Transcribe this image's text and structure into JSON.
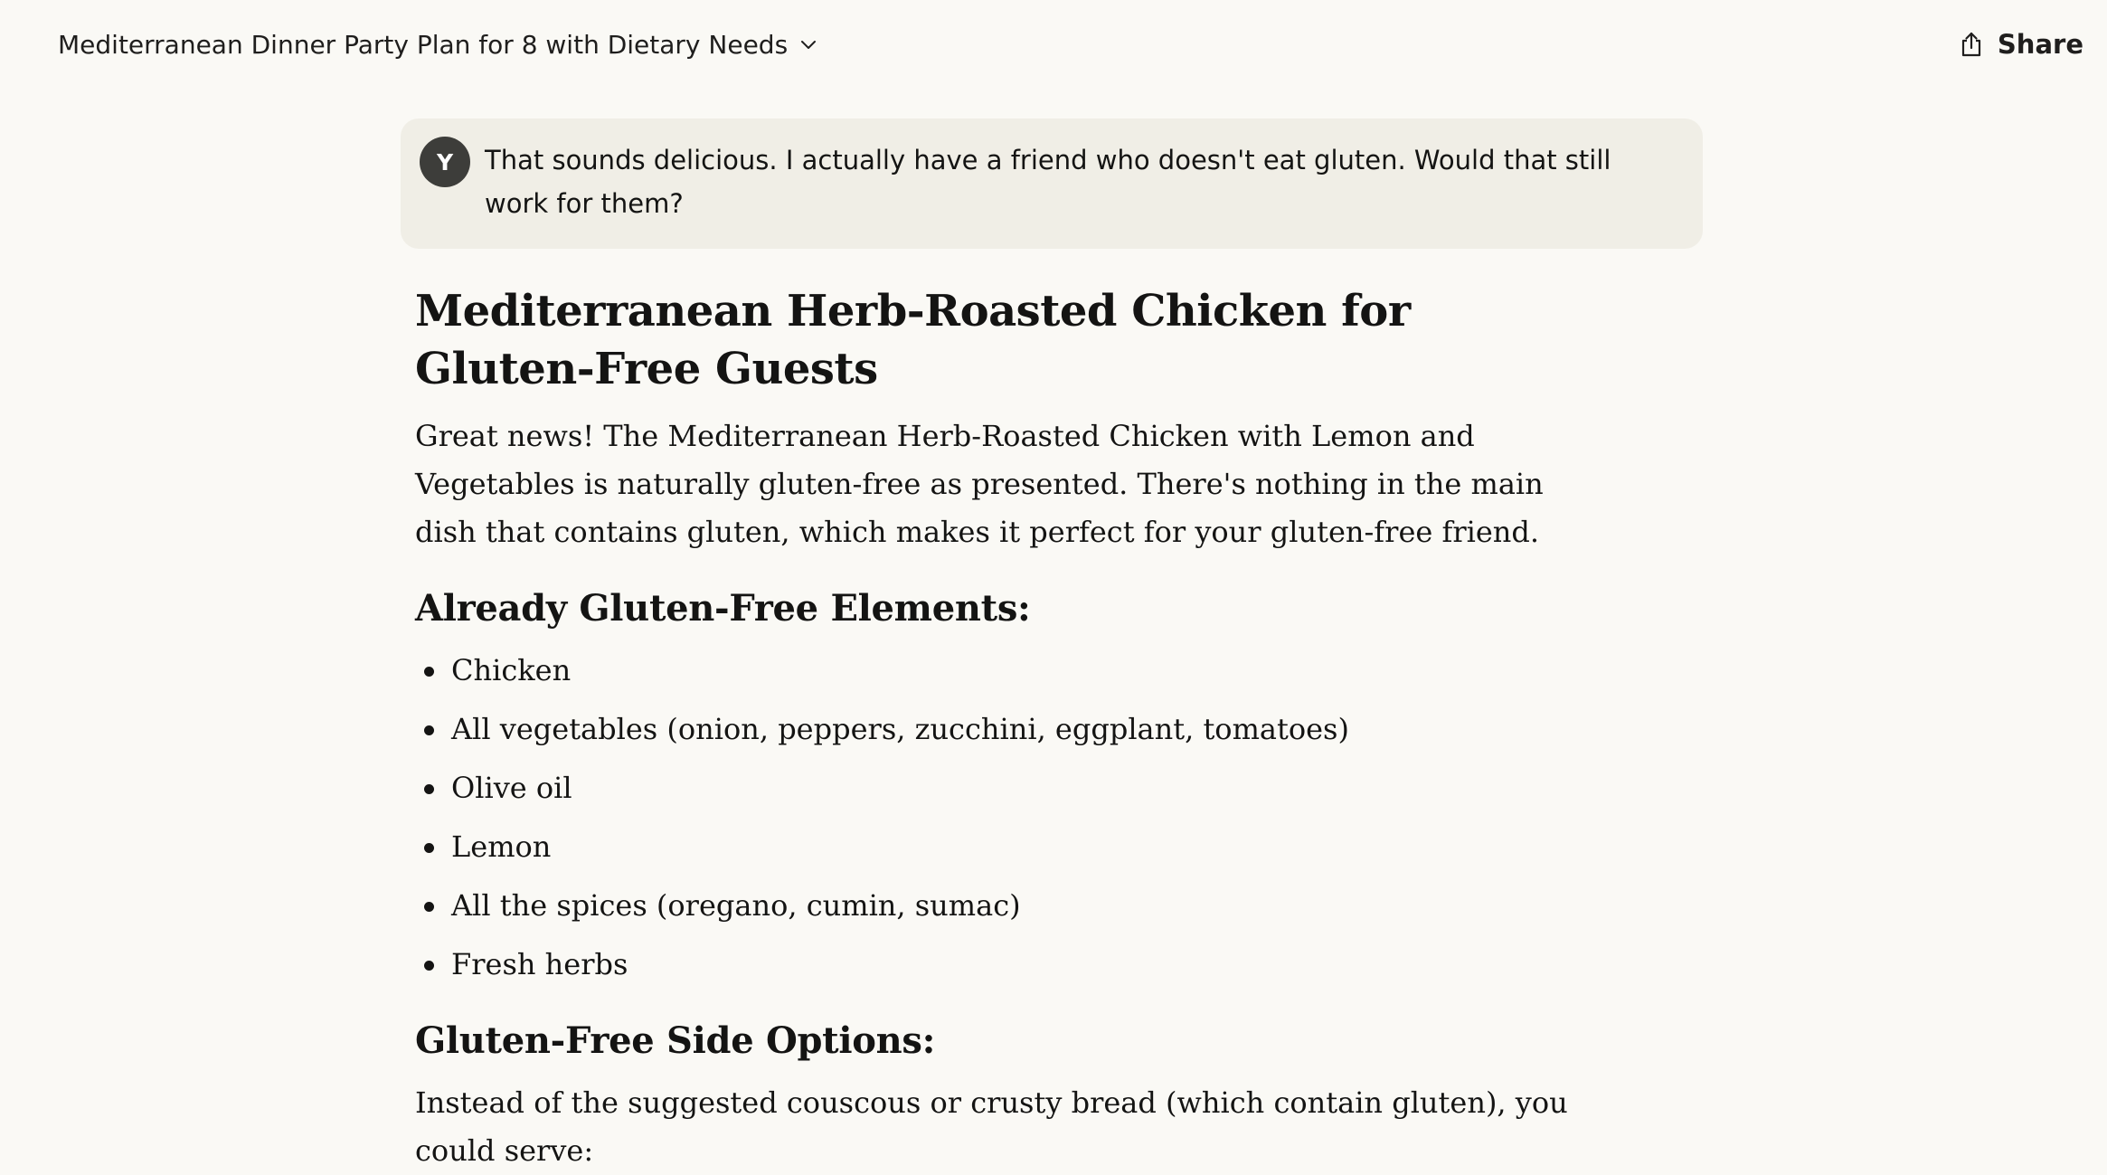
{
  "header": {
    "conversation_title": "Mediterranean Dinner Party Plan for 8 with Dietary Needs",
    "share_label": "Share"
  },
  "user_message": {
    "avatar_initial": "Y",
    "text": "That sounds delicious. I actually have a friend who doesn't eat gluten. Would that still work for them?"
  },
  "response": {
    "heading": "Mediterranean Herb-Roasted Chicken for Gluten-Free Guests",
    "intro": "Great news! The Mediterranean Herb-Roasted Chicken with Lemon and Vegetables is naturally gluten-free as presented. There's nothing in the main dish that contains gluten, which makes it perfect for your gluten-free friend.",
    "section1_heading": "Already Gluten-Free Elements:",
    "section1_items": [
      "Chicken",
      "All vegetables (onion, peppers, zucchini, eggplant, tomatoes)",
      "Olive oil",
      "Lemon",
      "All the spices (oregano, cumin, sumac)",
      "Fresh herbs"
    ],
    "section2_heading": "Gluten-Free Side Options:",
    "section2_intro": "Instead of the suggested couscous or crusty bread (which contain gluten), you could serve:"
  },
  "icons": {
    "title_dropdown": "chevron-down-icon",
    "share": "share-icon"
  },
  "colors": {
    "background": "#faf9f5",
    "user_bubble": "#f0eee6",
    "avatar": "#3d3d3a",
    "text": "#141413"
  }
}
